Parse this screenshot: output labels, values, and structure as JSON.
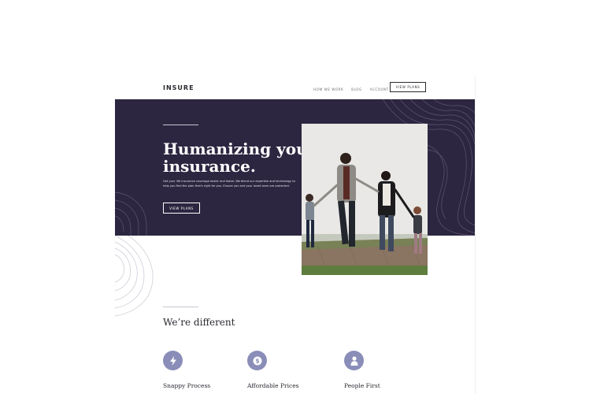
{
  "header": {
    "logo": "INSURE",
    "nav": [
      "HOW WE WORK",
      "BLOG",
      "ACCOUNT"
    ],
    "cta": "VIEW PLANS"
  },
  "hero": {
    "title": "Humanizing your insurance.",
    "text": "Get your life insurance coverage easier and faster. We blend our expertise and technology to help you find the plan that's right for you. Ensure you and your loved ones are protected.",
    "button": "VIEW PLANS"
  },
  "different": {
    "title": "We’re different",
    "features": [
      {
        "label": "Snappy Process",
        "icon": "lightning-icon"
      },
      {
        "label": "Affordable Prices",
        "icon": "dollar-icon"
      },
      {
        "label": "People First",
        "icon": "person-icon"
      }
    ]
  },
  "colors": {
    "hero_bg": "#2c2640",
    "icon_bg": "#8a8db8",
    "text_dark": "#2c2830"
  }
}
